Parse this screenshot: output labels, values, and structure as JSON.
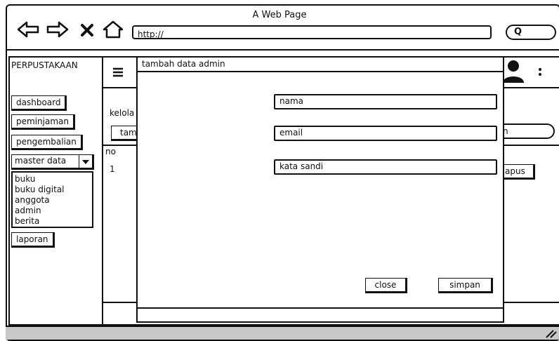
{
  "browser": {
    "title": "A Web Page",
    "url": "http://",
    "search_icon_label": "Q"
  },
  "app": {
    "brand": "PERPUSTAKAAN",
    "menu_icon": "hamburger-icon",
    "user_icon": "user-avatar-icon",
    "kebab_icon": "kebab-menu-icon"
  },
  "sidebar": {
    "dashboard": "dashboard",
    "peminjaman": "peminjaman",
    "pengembalian": "pengembalian",
    "master_data": "master data",
    "master_items": [
      "buku",
      "buku digital",
      "anggota",
      "admin",
      "berita"
    ],
    "laporan": "laporan"
  },
  "main": {
    "heading_partial": "kelola",
    "add_button_partial": "tam",
    "search_partial": "n",
    "table": {
      "header_no": "no",
      "row1_no": "1",
      "delete_partial": "apus"
    }
  },
  "modal": {
    "title": "tambah data admin",
    "fields": {
      "nama": "nama",
      "email": "email",
      "kata_sandi": "kata sandi"
    },
    "close": "close",
    "simpan": "simpan"
  }
}
